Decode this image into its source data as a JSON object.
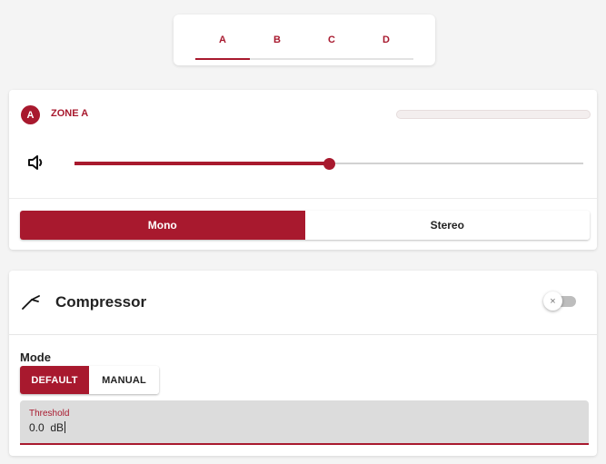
{
  "tabs": {
    "items": [
      "A",
      "B",
      "C",
      "D"
    ],
    "selected": "A"
  },
  "zone": {
    "badge": "A",
    "name": "ZONE A",
    "volume_percent": 50,
    "output_modes": [
      "Mono",
      "Stereo"
    ],
    "selected_output_mode": "Mono"
  },
  "compressor": {
    "title": "Compressor",
    "enabled": false,
    "toggle_glyph": "×",
    "mode_label": "Mode",
    "modes": [
      "DEFAULT",
      "MANUAL"
    ],
    "selected_mode": "DEFAULT",
    "threshold": {
      "label": "Threshold",
      "value": "0.0  dB"
    }
  },
  "icons": {
    "volume": "speaker-icon",
    "compressor": "compressor-curve-icon",
    "toggle_off": "close-icon"
  },
  "colors": {
    "accent": "#a8192e",
    "background": "#f4f4f4",
    "card": "#ffffff",
    "field_fill": "#dcdcdc"
  }
}
